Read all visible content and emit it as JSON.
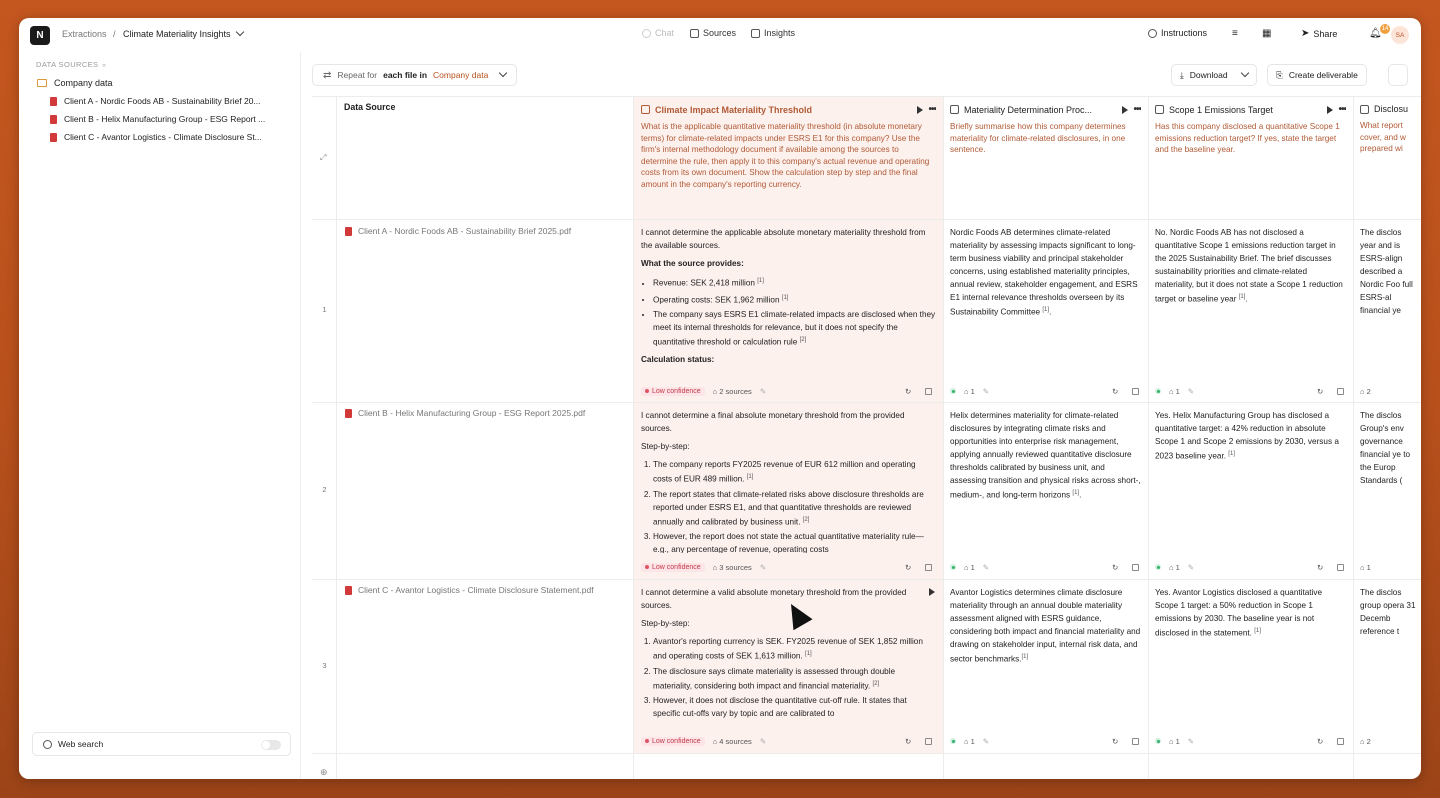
{
  "topbar": {
    "logo": "N",
    "breadcrumb": [
      "Extractions",
      "/",
      "Climate Materiality Insights"
    ],
    "tabs": [
      {
        "label": "Chat",
        "disabled": true
      },
      {
        "label": "Sources",
        "disabled": false
      },
      {
        "label": "Insights",
        "disabled": false
      }
    ],
    "instructions": "Instructions",
    "share": "Share",
    "notif_count": "14",
    "avatar": "SA"
  },
  "sidebar": {
    "heading": "DATA SOURCES",
    "folder": "Company data",
    "files": [
      "Client A - Nordic Foods AB - Sustainability Brief 20...",
      "Client B - Helix Manufacturing Group - ESG Report ...",
      "Client C - Avantor Logistics - Climate Disclosure St..."
    ],
    "web_search": "Web search"
  },
  "toolbar": {
    "repeat_for": "Repeat for",
    "each_file_in": "each file in",
    "scope": "Company data",
    "download": "Download",
    "create_deliverable": "Create deliverable"
  },
  "grid": {
    "source_header": "Data Source",
    "columns": [
      {
        "title": "Climate Impact Materiality Threshold",
        "question": "What is the applicable quantitative materiality threshold (in absolute monetary terms) for climate-related impacts under ESRS E1 for this company? Use the firm's internal methodology document if available among the sources to determine the rule, then apply it to this company's actual revenue and operating costs from its own document. Show the calculation step by step and the final amount in the company's reporting currency."
      },
      {
        "title": "Materiality Determination Proc...",
        "question": "Briefly summarise how this company determines materiality for climate-related disclosures, in one sentence."
      },
      {
        "title": "Scope 1 Emissions Target",
        "question": "Has this company disclosed a quantitative Scope 1 emissions reduction target? If yes, state the target and the baseline year."
      },
      {
        "title": "Disclosu",
        "question": "What report cover, and w prepared wi"
      }
    ],
    "rows": [
      {
        "index": "1",
        "source": "Client A - Nordic Foods AB - Sustainability Brief 2025.pdf",
        "c1_intro": "I cannot determine the applicable absolute monetary materiality threshold from the available sources.",
        "c1_sub": "What the source provides:",
        "c1_items": [
          "Revenue: SEK 2,418 million",
          "Operating costs: SEK 1,962 million",
          "The company says ESRS E1 climate-related impacts are disclosed when they meet its internal thresholds for relevance, but it does not specify the quantitative threshold or calculation rule"
        ],
        "c1_refs": [
          "[1]",
          "[1]",
          "[2]"
        ],
        "c1_tail": "Calculation status:",
        "c1_conf": "Low confidence",
        "c1_sources": "2 sources",
        "c2": "Nordic Foods AB determines climate-related materiality by assessing impacts significant to long-term business viability and principal stakeholder concerns, using established materiality principles, annual review, stakeholder engagement, and ESRS E1 internal relevance thresholds overseen by its Sustainability Committee",
        "c2_ref": "[1]",
        "c3": "No. Nordic Foods AB has not disclosed a quantitative Scope 1 emissions reduction target in the 2025 Sustainability Brief. The brief discusses sustainability priorities and climate-related materiality, but it does not state a Scope 1 reduction target or baseline year",
        "c3_ref": "[1]",
        "c4": "The disclos year and is ESRS-align described a Nordic Foo full ESRS-al financial ye",
        "count": "1",
        "count4": "2"
      },
      {
        "index": "2",
        "source": "Client B - Helix Manufacturing Group - ESG Report 2025.pdf",
        "c1_intro": "I cannot determine a final absolute monetary threshold from the provided sources.",
        "c1_sub": "Step-by-step:",
        "c1_items": [
          "The company reports FY2025 revenue of EUR 612 million and operating costs of EUR 489 million.",
          "The report states that climate-related risks above disclosure thresholds are reported under ESRS E1, and that quantitative thresholds are reviewed annually and calibrated by business unit.",
          "However, the report does not state the actual quantitative materiality rule—e.g., any percentage of revenue, operating costs"
        ],
        "c1_refs": [
          "[1]",
          "[2]",
          ""
        ],
        "c1_conf": "Low confidence",
        "c1_sources": "3 sources",
        "c2": "Helix determines materiality for climate-related disclosures by integrating climate risks and opportunities into enterprise risk management, applying annually reviewed quantitative disclosure thresholds calibrated by business unit, and assessing transition and physical risks across short-, medium-, and long-term horizons",
        "c2_ref": "[1]",
        "c3": "Yes. Helix Manufacturing Group has disclosed a quantitative target: a 42% reduction in absolute Scope 1 and Scope 2 emissions by 2030, versus a 2023 baseline year.",
        "c3_ref": "[1]",
        "c4": "The disclos Group's env governance financial ye to the Europ Standards (",
        "count": "1",
        "count4": "1"
      },
      {
        "index": "3",
        "source": "Client C - Avantor Logistics - Climate Disclosure Statement.pdf",
        "c1_intro": "I cannot determine a valid absolute monetary threshold from the provided sources.",
        "c1_sub": "Step-by-step:",
        "c1_items": [
          "Avantor's reporting currency is SEK. FY2025 revenue of SEK 1,852 million and operating costs of SEK 1,613 million.",
          "The disclosure says climate materiality is assessed through double materiality, considering both impact and financial materiality.",
          "However, it does not disclose the quantitative cut-off rule. It states that specific cut-offs vary by topic and are calibrated to"
        ],
        "c1_refs": [
          "[1]",
          "[2]",
          ""
        ],
        "c1_conf": "Low confidence",
        "c1_sources": "4 sources",
        "c2": "Avantor Logistics determines climate disclosure materiality through an annual double materiality assessment aligned with ESRS guidance, considering both impact and financial materiality and drawing on stakeholder input, internal risk data, and sector benchmarks.",
        "c2_ref": "[1]",
        "c3": "Yes. Avantor Logistics disclosed a quantitative Scope 1 target: a 50% reduction in Scope 1 emissions by 2030. The baseline year is not disclosed in the statement.",
        "c3_ref": "[1]",
        "c4": "The disclos group opera 31 Decemb reference t",
        "count": "1",
        "count4": "2"
      }
    ]
  },
  "colors": {
    "accent": "#b8501c",
    "question_text": "#b05a35",
    "highlight_column": "#fdf1ee",
    "low_confidence_bg": "#fde4e6",
    "low_confidence_text": "#c2384a",
    "ok_green": "#34b36d"
  }
}
